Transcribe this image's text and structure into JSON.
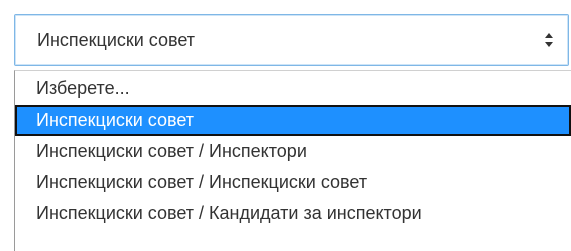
{
  "select": {
    "current_value": "Инспекциски совет",
    "arrow_icon": "updown-arrows-icon"
  },
  "dropdown": {
    "options": [
      {
        "label": "Изберете..."
      },
      {
        "label": "Инспекциски совет",
        "selected": true
      },
      {
        "label": "Инспекциски совет / Инспектори"
      },
      {
        "label": "Инспекциски совет / Инспекциски совет"
      },
      {
        "label": "Инспекциски совет / Кандидати за инспектори"
      }
    ]
  },
  "colors": {
    "highlight": "#1e90ff",
    "select_border": "#7fb7e6",
    "text": "#333333"
  }
}
